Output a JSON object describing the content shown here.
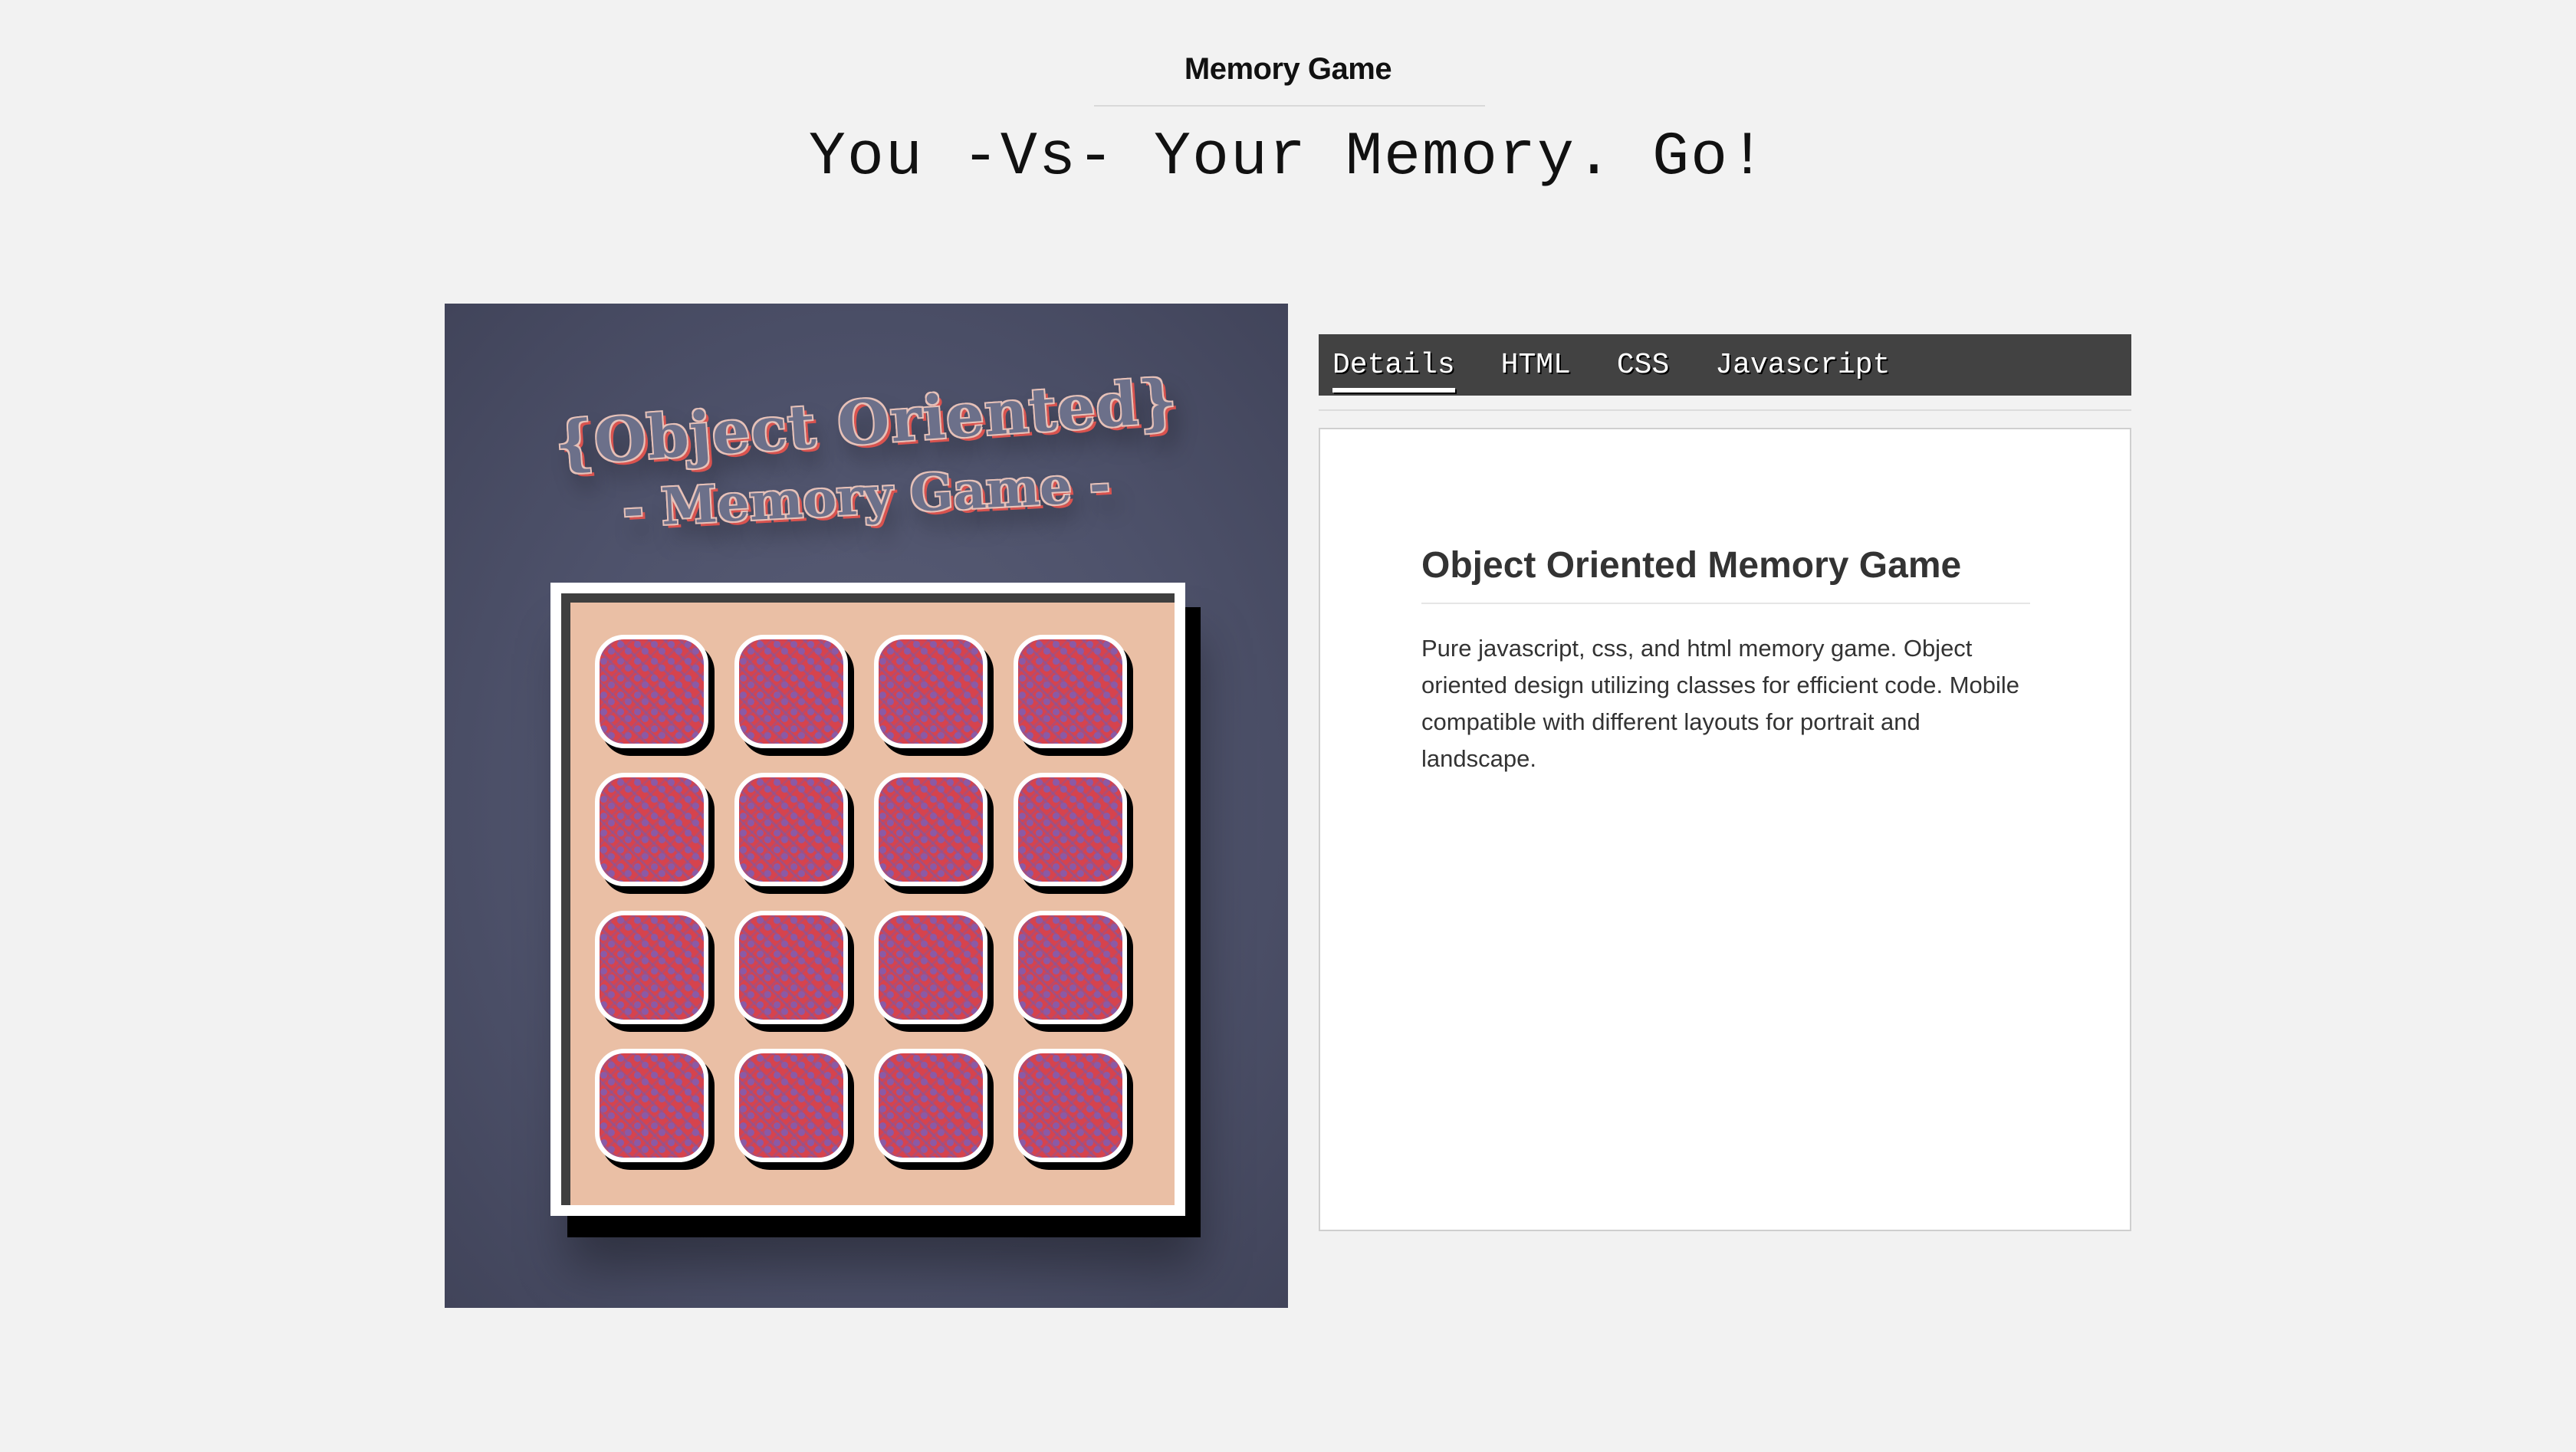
{
  "header": {
    "site_title": "Memory Game",
    "tagline": "You -Vs- Your Memory. Go!"
  },
  "preview": {
    "title": "{Object Oriented}",
    "subtitle": "- Memory Game -",
    "card_count": 16,
    "colors": {
      "background": "#4e526b",
      "board": "#eabfa5",
      "card": "#d6434d",
      "card_pattern": "#8a5aa6"
    }
  },
  "tabs": [
    {
      "label": "Details",
      "active": true
    },
    {
      "label": "HTML",
      "active": false
    },
    {
      "label": "CSS",
      "active": false
    },
    {
      "label": "Javascript",
      "active": false
    }
  ],
  "details": {
    "heading": "Object Oriented Memory Game",
    "description": "Pure javascript, css, and html memory game. Object oriented design utilizing classes for efficient code. Mobile compatible with different layouts for portrait and landscape."
  }
}
